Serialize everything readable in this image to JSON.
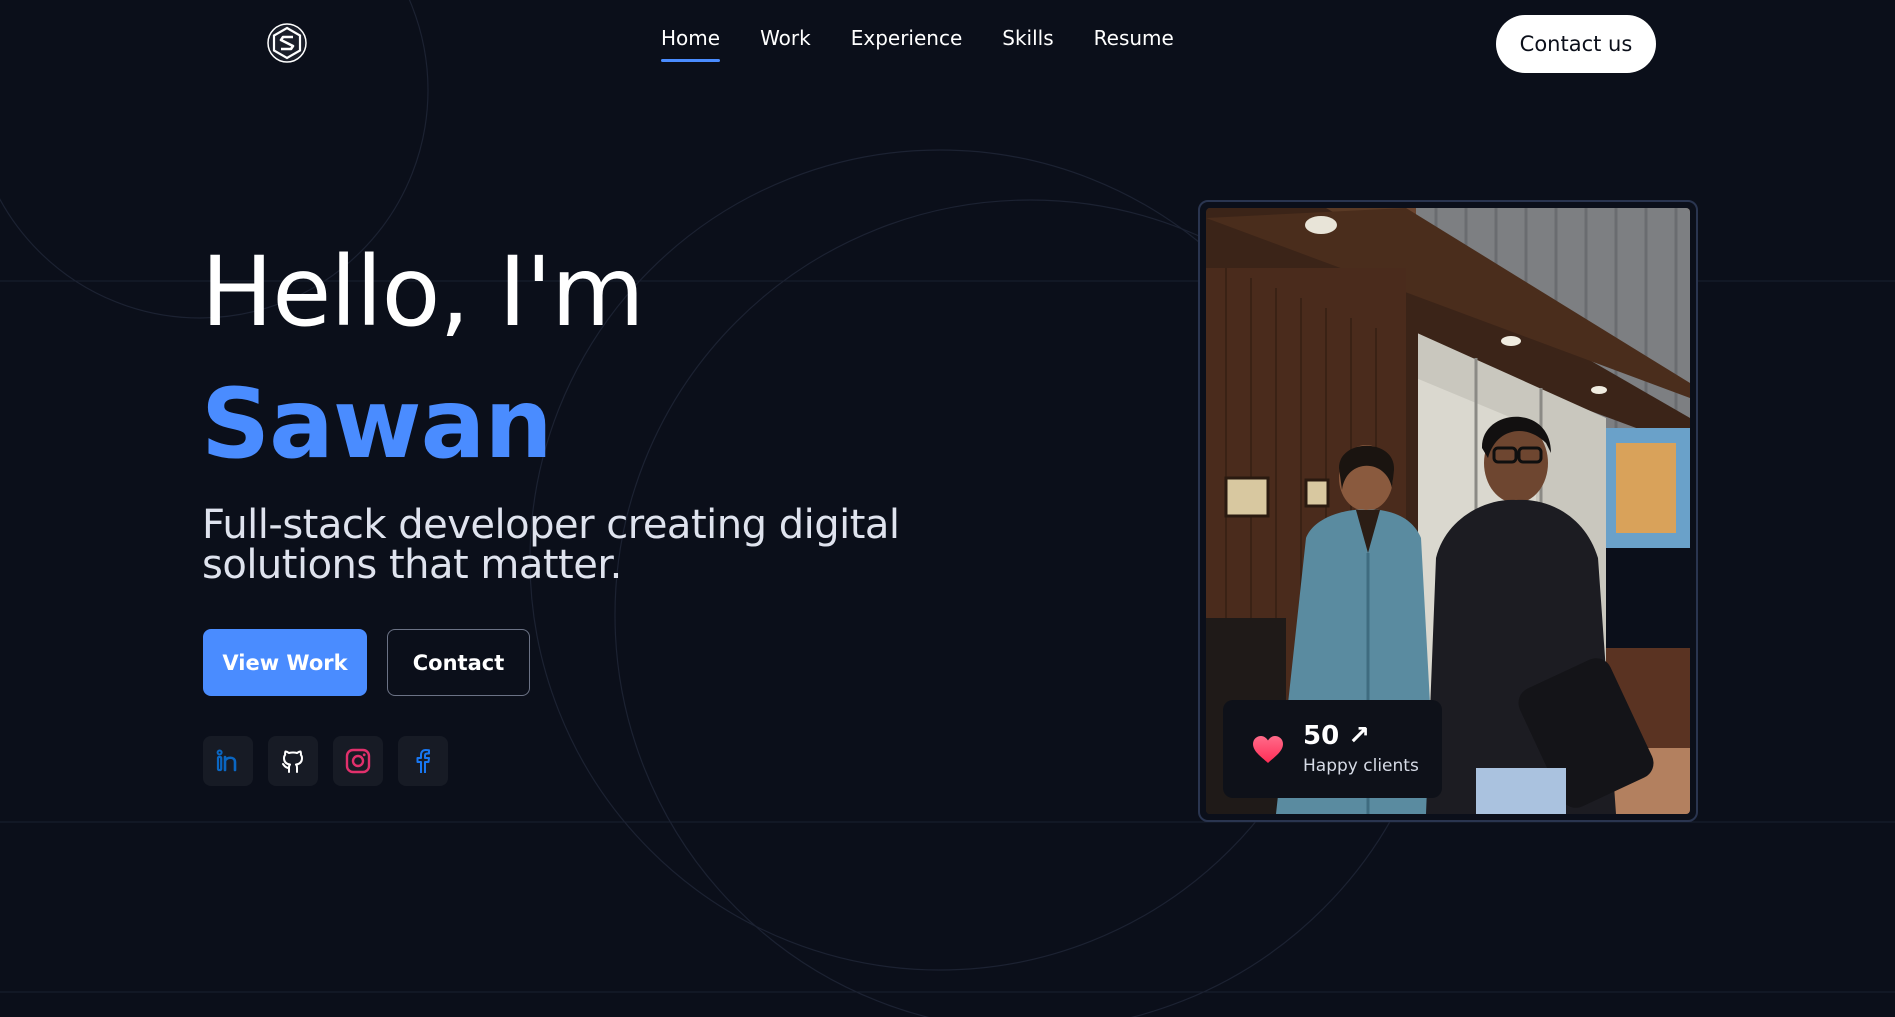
{
  "header": {
    "logo_alt": "S logo",
    "nav": [
      {
        "label": "Home",
        "active": true
      },
      {
        "label": "Work",
        "active": false
      },
      {
        "label": "Experience",
        "active": false
      },
      {
        "label": "Skills",
        "active": false
      },
      {
        "label": "Resume",
        "active": false
      }
    ],
    "cta_label": "Contact us"
  },
  "hero": {
    "greeting": "Hello, I'm",
    "name": "Sawan",
    "tagline": "Full-stack developer creating digital solutions that matter.",
    "primary_button": "View Work",
    "secondary_button": "Contact",
    "socials": [
      {
        "name": "linkedin-icon",
        "color": "#0a66c2"
      },
      {
        "name": "github-icon",
        "color": "#ffffff"
      },
      {
        "name": "instagram-icon",
        "color": "#e1306c"
      },
      {
        "name": "facebook-icon",
        "color": "#1877f2"
      }
    ]
  },
  "stat": {
    "value": "50 ↗",
    "label": "Happy clients",
    "icon": "heart-icon"
  },
  "colors": {
    "background": "#0b0f1a",
    "accent": "#4a8cff",
    "heart": "#ff3b6b"
  }
}
